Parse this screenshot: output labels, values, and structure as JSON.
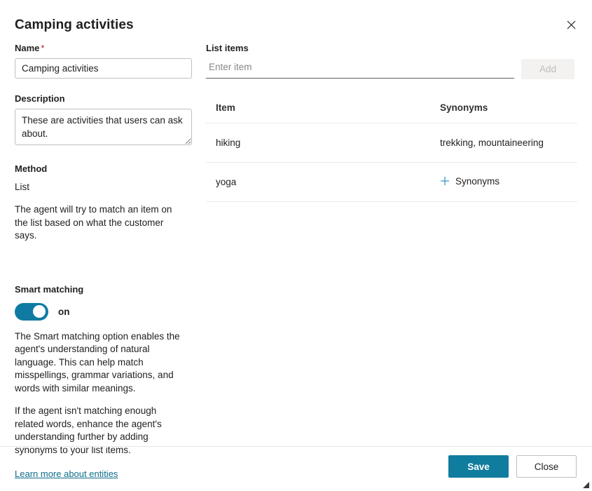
{
  "dialog": {
    "title": "Camping activities",
    "close_icon": "close-icon"
  },
  "left": {
    "name": {
      "label": "Name",
      "required_marker": "*",
      "value": "Camping activities",
      "placeholder": "Name"
    },
    "description": {
      "label": "Description",
      "value": "These are activities that users can ask about.",
      "placeholder": "Description"
    },
    "method": {
      "label": "Method",
      "value": "List",
      "help": "The agent will try to match an item on the list based on what the customer says."
    },
    "smart_matching": {
      "label": "Smart matching",
      "state": "on",
      "toggle_on": true,
      "help_1": "The Smart matching option enables the agent's understanding of natural language. This can help match misspellings, grammar variations, and words with similar meanings.",
      "help_2": "If the agent isn't matching enough related words, enhance the agent's understanding further by adding synonyms to your list items."
    },
    "learn_more_link": "Learn more about entities"
  },
  "right": {
    "list_items_label": "List items",
    "item_input_placeholder": "Enter item",
    "item_input_value": "",
    "add_button": "Add",
    "table": {
      "columns": [
        "Item",
        "Synonyms"
      ],
      "rows": [
        {
          "item": "hiking",
          "synonyms": "trekking, mountaineering",
          "has_synonyms": true
        },
        {
          "item": "yoga",
          "synonyms": "Synonyms",
          "has_synonyms": false
        }
      ]
    }
  },
  "footer": {
    "save_label": "Save",
    "close_label": "Close"
  },
  "colors": {
    "accent": "#107c9e",
    "toggle_on": "#0f7ba3",
    "link": "#0f6e8c",
    "required": "#a4262c",
    "plus_icon": "#3a96c8",
    "divider": "#edebe9"
  }
}
